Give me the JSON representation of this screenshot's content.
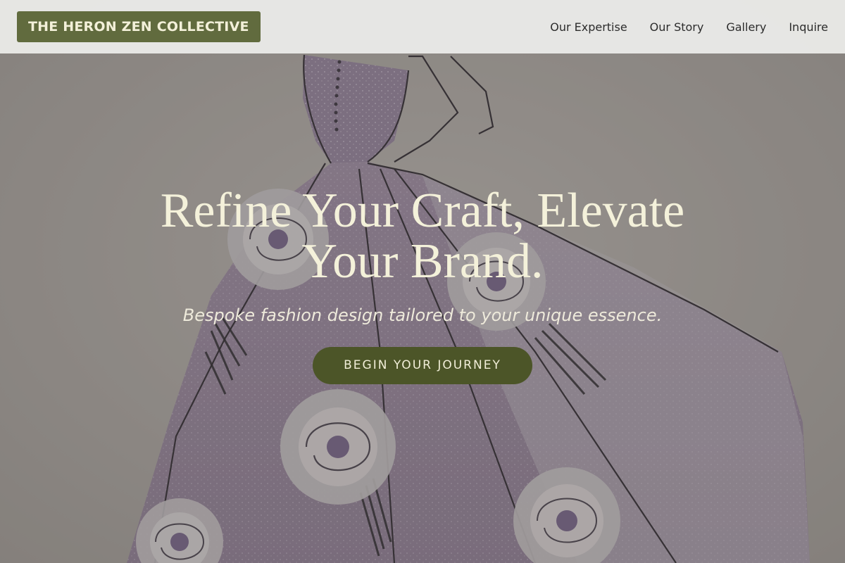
{
  "header": {
    "logo_text": "THE HERON ZEN COLLECTIVE",
    "nav": [
      {
        "label": "Our Expertise"
      },
      {
        "label": "Our Story"
      },
      {
        "label": "Gallery"
      },
      {
        "label": "Inquire"
      }
    ]
  },
  "hero": {
    "title_line1": "Refine Your Craft, Elevate",
    "title_line2": "Your Brand.",
    "subtitle": "Bespoke fashion design tailored to your unique essence.",
    "cta_label": "BEGIN YOUR JOURNEY",
    "background_image": "fashion-sketch-gown-illustration"
  },
  "colors": {
    "brand_olive": "#616b3e",
    "cta_olive": "#4c5528",
    "cream_text": "#f4f1da",
    "header_bg": "#ececea"
  }
}
